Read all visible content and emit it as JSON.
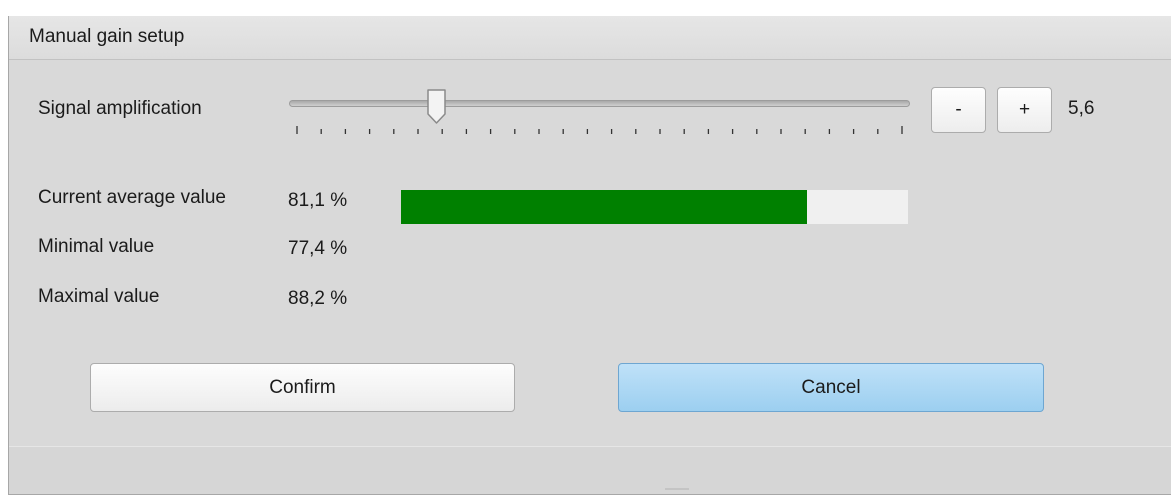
{
  "window": {
    "title": "Manual gain setup"
  },
  "amplification": {
    "label": "Signal amplification",
    "value_text": "5,6",
    "slider_fraction": 0.23,
    "tick_count": 26,
    "minus_label": "-",
    "plus_label": "+"
  },
  "stats": {
    "current_label": "Current average value",
    "current_value": "81,1 %",
    "current_fraction": 0.801,
    "min_label": "Minimal value",
    "min_value": "77,4 %",
    "max_label": "Maximal value",
    "max_value": "88,2 %"
  },
  "buttons": {
    "confirm_label": "Confirm",
    "cancel_label": "Cancel"
  },
  "colors": {
    "progress_fill": "#008000",
    "cancel_accent": "#9ccff0"
  }
}
